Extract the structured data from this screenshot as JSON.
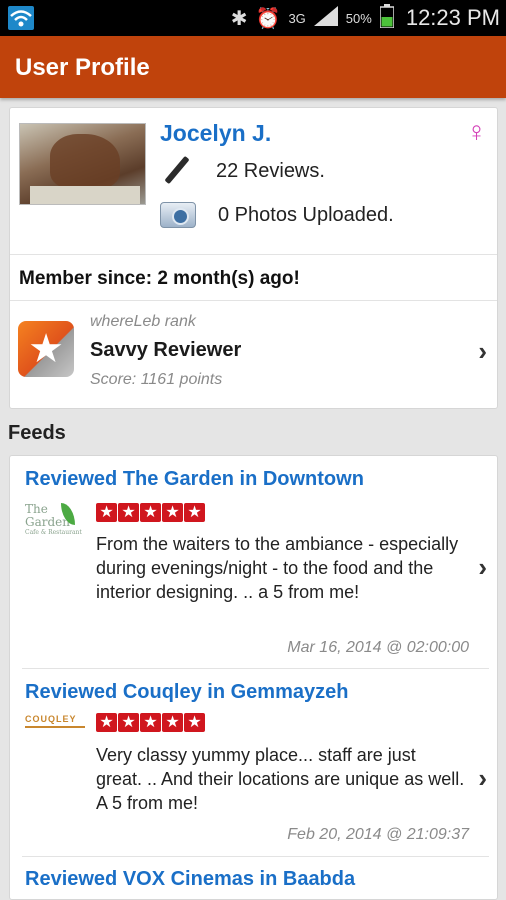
{
  "status_bar": {
    "network": "3G",
    "battery": "50%",
    "time": "12:23 PM"
  },
  "header": {
    "title": "User Profile"
  },
  "profile": {
    "name": "Jocelyn J.",
    "gender_icon": "female-symbol",
    "reviews": "22 Reviews.",
    "photos": "0 Photos Uploaded.",
    "member_since": "Member since: 2 month(s) ago!",
    "rank": {
      "caption": "whereLeb rank",
      "title": "Savvy Reviewer",
      "score": "Score: 1161 points"
    }
  },
  "feeds": {
    "title": "Feeds",
    "items": [
      {
        "title": "Reviewed The Garden in Downtown",
        "logo_lines": [
          "The",
          "Garden",
          "Cafe & Restaurant"
        ],
        "rating": 5,
        "text": "From the waiters to the ambiance - especially during evenings/night - to the food and the interior designing. .. a 5 from me!",
        "date": "Mar 16, 2014 @ 02:00:00"
      },
      {
        "title": "Reviewed Couqley in Gemmayzeh",
        "logo_text": "COUQLEY",
        "rating": 5,
        "text": "Very classy yummy place... staff are just great. .. And their locations are unique as well.  A 5 from me!",
        "date": "Feb 20, 2014 @ 21:09:37"
      },
      {
        "title": "Reviewed VOX Cinemas in Baabda"
      }
    ]
  },
  "colors": {
    "action_bar": "#c0430c",
    "link_blue": "#1a6fc7",
    "star_red": "#d0161e",
    "gender_pink": "#d43fb8"
  }
}
